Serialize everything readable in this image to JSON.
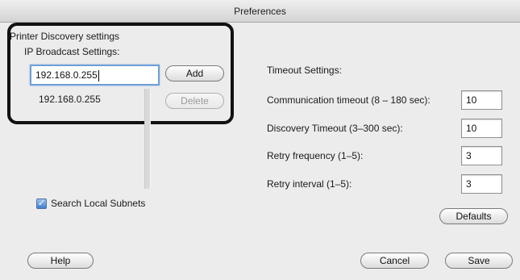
{
  "window": {
    "title": "Preferences"
  },
  "discovery": {
    "section_title": "Printer Discovery settings",
    "ip_broadcast_label": "IP Broadcast Settings:",
    "ip_input_value": "192.168.0.255",
    "add_label": "Add",
    "delete_label": "Delete",
    "list_items": [
      "192.168.0.255"
    ],
    "search_local_label": "Search Local Subnets",
    "search_local_checked": true
  },
  "timeout": {
    "title": "Timeout Settings:",
    "rows": [
      {
        "label": "Communication timeout (8 – 180 sec):",
        "value": "10"
      },
      {
        "label": "Discovery Timeout (3–300 sec):",
        "value": "10"
      },
      {
        "label": "Retry frequency (1–5):",
        "value": "3"
      },
      {
        "label": "Retry interval (1–5):",
        "value": "3"
      }
    ],
    "defaults_label": "Defaults"
  },
  "footer": {
    "help_label": "Help",
    "cancel_label": "Cancel",
    "save_label": "Save"
  }
}
